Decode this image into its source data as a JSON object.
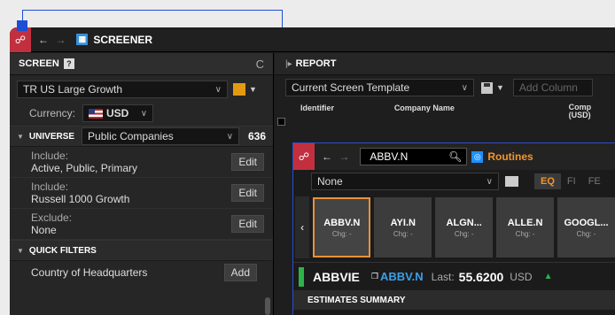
{
  "titlebar": {
    "app_icon": "screener-grid-icon",
    "title": "SCREENER"
  },
  "screen": {
    "header": "SCREEN",
    "help_icon_text": "?",
    "refresh_icon": "↻",
    "template_value": "TR US Large Growth",
    "currency_label": "Currency:",
    "currency_value": "USD",
    "universe": {
      "title": "UNIVERSE",
      "value": "Public Companies",
      "count": "636"
    },
    "rules": [
      {
        "label": "Include:",
        "value": "Active, Public, Primary",
        "action": "Edit"
      },
      {
        "label": "Include:",
        "value": "Russell 1000 Growth",
        "action": "Edit"
      },
      {
        "label": "Exclude:",
        "value": "None",
        "action": "Edit"
      }
    ],
    "quick_filters": {
      "title": "QUICK FILTERS",
      "items": [
        {
          "label": "Country of Headquarters",
          "action": "Add"
        }
      ]
    }
  },
  "report": {
    "header": "REPORT",
    "template": "Current Screen Template",
    "add_column_placeholder": "Add Column",
    "columns": [
      "Identifier",
      "Company Name",
      "Comp (USD)"
    ]
  },
  "quote": {
    "ric_input": "ABBV.N",
    "routines_label": "Routines",
    "filter_value": "None",
    "asset_tabs": [
      "EQ",
      "FI",
      "FE"
    ],
    "active_asset_tab": "EQ",
    "tiles": [
      {
        "ric": "ABBV.N",
        "chg": "Chg: -"
      },
      {
        "ric": "AYI.N",
        "chg": "Chg: -"
      },
      {
        "ric": "ALGN...",
        "chg": "Chg: -"
      },
      {
        "ric": "ALLE.N",
        "chg": "Chg: -"
      },
      {
        "ric": "GOOGL...",
        "chg": "Chg: -"
      }
    ],
    "selected_tile": "ABBV.N",
    "name": "ABBVIE",
    "ric": "ABBV.N",
    "last_label": "Last:",
    "last_value": "55.6200",
    "currency": "USD",
    "section": "ESTIMATES SUMMARY"
  },
  "colors": {
    "accent_orange": "#f3952a",
    "logo_red": "#c23040",
    "link_blue": "#3aa0e8",
    "up_green": "#2db34a",
    "selection_blue": "#1a4fd6"
  }
}
